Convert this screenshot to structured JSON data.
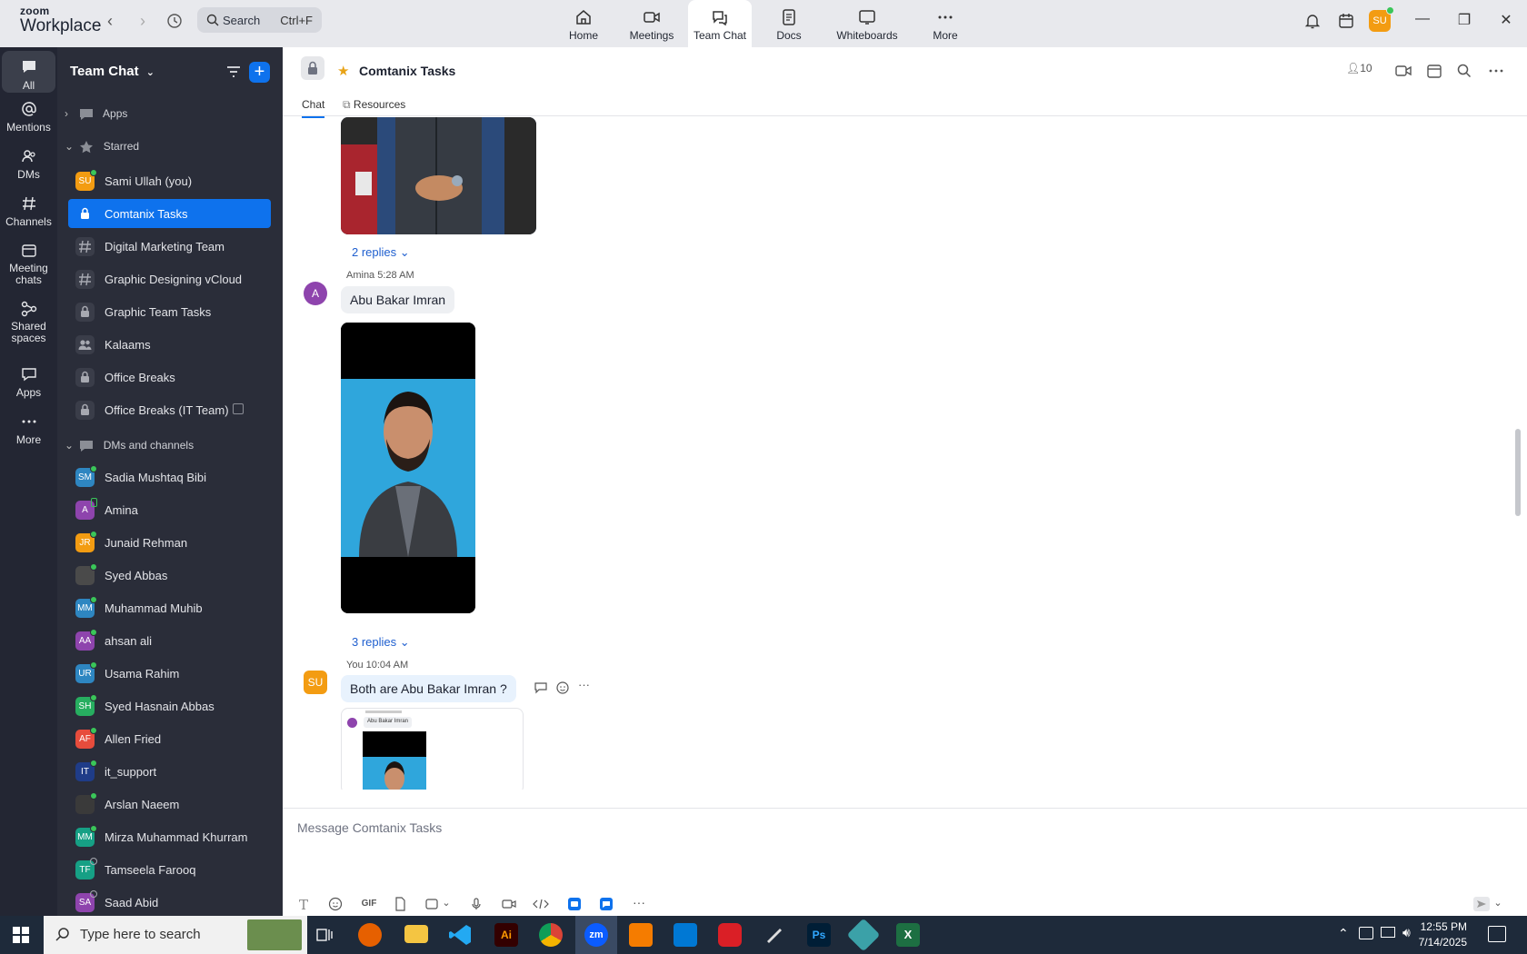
{
  "topbar": {
    "logo_small": "zoom",
    "logo_big": "Workplace",
    "search_placeholder": "Search",
    "search_shortcut": "Ctrl+F",
    "tabs": [
      {
        "label": "Home",
        "icon": "home-icon"
      },
      {
        "label": "Meetings",
        "icon": "video-icon"
      },
      {
        "label": "Team Chat",
        "icon": "chat-icon",
        "active": true
      },
      {
        "label": "Docs",
        "icon": "doc-icon"
      },
      {
        "label": "Whiteboards",
        "icon": "whiteboard-icon"
      },
      {
        "label": "More",
        "icon": "more-icon"
      }
    ],
    "user_initials": "SU"
  },
  "rail": [
    {
      "label": "All",
      "icon": "chat-bubble-icon",
      "active": true
    },
    {
      "label": "Mentions",
      "icon": "at-icon"
    },
    {
      "label": "DMs",
      "icon": "people-icon"
    },
    {
      "label": "Channels",
      "icon": "hash-icon"
    },
    {
      "label": "Meeting chats",
      "icon": "calendar-icon"
    },
    {
      "label": "Shared spaces",
      "icon": "shared-icon"
    },
    {
      "label": "Apps",
      "icon": "apps-icon"
    },
    {
      "label": "More",
      "icon": "more-icon"
    }
  ],
  "sidebar": {
    "title": "Team Chat",
    "apps_label": "Apps",
    "starred_label": "Starred",
    "dms_label": "DMs and channels",
    "starred": [
      {
        "name": "Sami Ullah (you)",
        "initials": "SU",
        "color": "#f39c12",
        "type": "person",
        "presence": "on"
      },
      {
        "name": "Comtanix Tasks",
        "icon": "lock-icon",
        "type": "channel",
        "selected": true
      },
      {
        "name": "Digital Marketing Team",
        "icon": "hash-icon",
        "type": "channel"
      },
      {
        "name": "Graphic Designing vCloud",
        "icon": "hash-icon",
        "type": "channel"
      },
      {
        "name": "Graphic Team Tasks",
        "icon": "lock-icon",
        "type": "channel"
      },
      {
        "name": "Kalaams",
        "icon": "group-icon",
        "type": "channel"
      },
      {
        "name": "Office Breaks",
        "icon": "lock-icon",
        "type": "channel"
      },
      {
        "name": "Office Breaks (IT Team)",
        "icon": "lock-icon",
        "type": "channel",
        "external": true
      }
    ],
    "dms": [
      {
        "name": "Sadia Mushtaq Bibi",
        "initials": "SM",
        "color": "#2e86c1",
        "presence": "on"
      },
      {
        "name": "Amina",
        "initials": "A",
        "color": "#8e44ad",
        "presence": "mobile"
      },
      {
        "name": "Junaid Rehman",
        "initials": "JR",
        "color": "#f39c12",
        "presence": "on"
      },
      {
        "name": "Syed Abbas",
        "initials": "",
        "color": "#4a4a4a",
        "presence": "on"
      },
      {
        "name": "Muhammad Muhib",
        "initials": "MM",
        "color": "#2e86c1",
        "presence": "on"
      },
      {
        "name": "ahsan ali",
        "initials": "AA",
        "color": "#8e44ad",
        "presence": "on"
      },
      {
        "name": "Usama Rahim",
        "initials": "UR",
        "color": "#2e86c1",
        "presence": "on"
      },
      {
        "name": "Syed Hasnain Abbas",
        "initials": "SH",
        "color": "#27ae60",
        "presence": "on"
      },
      {
        "name": "Allen Fried",
        "initials": "AF",
        "color": "#e74c3c",
        "presence": "on"
      },
      {
        "name": "it_support",
        "initials": "IT",
        "color": "#1f3c88",
        "presence": "on"
      },
      {
        "name": "Arslan Naeem",
        "initials": "",
        "color": "#3a3a3a",
        "presence": "on"
      },
      {
        "name": "Mirza Muhammad Khurram",
        "initials": "MM",
        "color": "#16a085",
        "presence": "on"
      },
      {
        "name": "Tamseela Farooq",
        "initials": "TF",
        "color": "#16a085",
        "presence": "off"
      },
      {
        "name": "Saad Abid",
        "initials": "SA",
        "color": "#8e44ad",
        "presence": "off"
      }
    ]
  },
  "chat": {
    "title": "Comtanix Tasks",
    "tabs": [
      "Chat",
      "Resources"
    ],
    "member_count": "10",
    "messages": [
      {
        "replies": "2 replies"
      },
      {
        "author": "Amina",
        "time": "5:28 AM",
        "text": "Abu Bakar Imran",
        "initials": "A",
        "replies": "3 replies"
      },
      {
        "author": "You",
        "time": "10:04 AM",
        "text": "Both are Abu Bakar Imran ?",
        "initials": "SU",
        "quote_text": "Abu Bakar Imran"
      }
    ],
    "input_placeholder": "Message Comtanix Tasks",
    "toolbar_gif": "GIF"
  },
  "taskbar": {
    "search_placeholder": "Type here to search",
    "time": "12:55 PM",
    "date": "7/14/2025"
  }
}
